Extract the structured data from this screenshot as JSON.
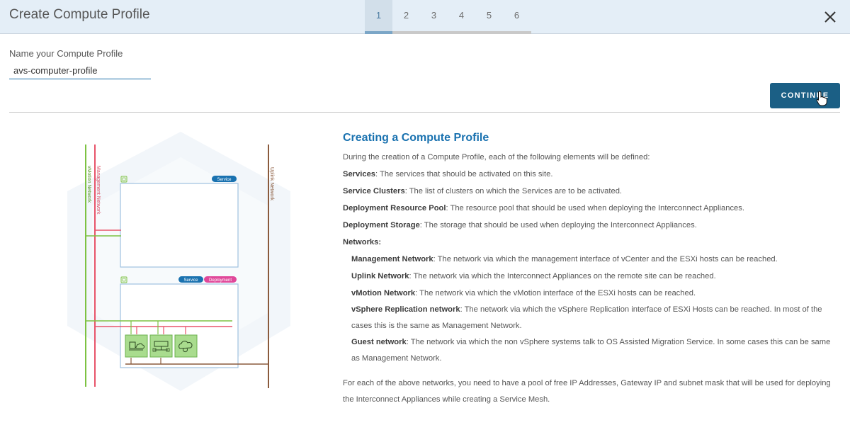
{
  "header": {
    "title": "Create Compute Profile",
    "steps": [
      "1",
      "2",
      "3",
      "4",
      "5",
      "6"
    ],
    "active_step": 1
  },
  "form": {
    "name_label": "Name your Compute Profile",
    "name_value": "avs-computer-profile",
    "continue_label": "CONTINUE"
  },
  "diagram": {
    "networks": [
      "vMotion Network",
      "Management Network",
      "Uplink Network"
    ],
    "badges": {
      "service": "Service",
      "deployment": "Deployment"
    }
  },
  "info": {
    "heading": "Creating a Compute Profile",
    "intro": "During the creation of a Compute Profile, each of the following elements will be defined:",
    "items": [
      {
        "term": "Services",
        "desc": ": The services that should be activated on this site."
      },
      {
        "term": "Service Clusters",
        "desc": ": The list of clusters on which the Services are to be activated."
      },
      {
        "term": "Deployment Resource Pool",
        "desc": ": The resource pool that should be used when deploying the Interconnect Appliances."
      },
      {
        "term": "Deployment Storage",
        "desc": ": The storage that should be used when deploying the Interconnect Appliances."
      }
    ],
    "networks_label": "Networks:",
    "networks": [
      {
        "term": "Management Network",
        "desc": ": The network via which the management interface of vCenter and the ESXi hosts can be reached."
      },
      {
        "term": "Uplink Network",
        "desc": ": The network via which the Interconnect Appliances on the remote site can be reached."
      },
      {
        "term": "vMotion Network",
        "desc": ": The network via which the vMotion interface of the ESXi hosts can be reached."
      },
      {
        "term": "vSphere Replication network",
        "desc": ": The network via which the vSphere Replication interface of ESXi Hosts can be reached. In most of the cases this is the same as Management Network."
      },
      {
        "term": "Guest network",
        "desc": ": The network via which the non vSphere systems talk to OS Assisted Migration Service. In some cases this can be same as Management Network."
      }
    ],
    "footer": "For each of the above networks, you need to have a pool of free IP Addresses, Gateway IP and subnet mask that will be used for deploying the Interconnect Appliances while creating a Service Mesh."
  },
  "colors": {
    "accent": "#1b5f85",
    "heading": "#1a72b0",
    "header_bg": "#e4eef7",
    "vmotion": "#7dc242",
    "management": "#e8546a",
    "uplink": "#8a5a3c"
  },
  "icons": [
    "close-icon",
    "hand-cursor-icon",
    "cluster-icon",
    "appliance-icon"
  ]
}
